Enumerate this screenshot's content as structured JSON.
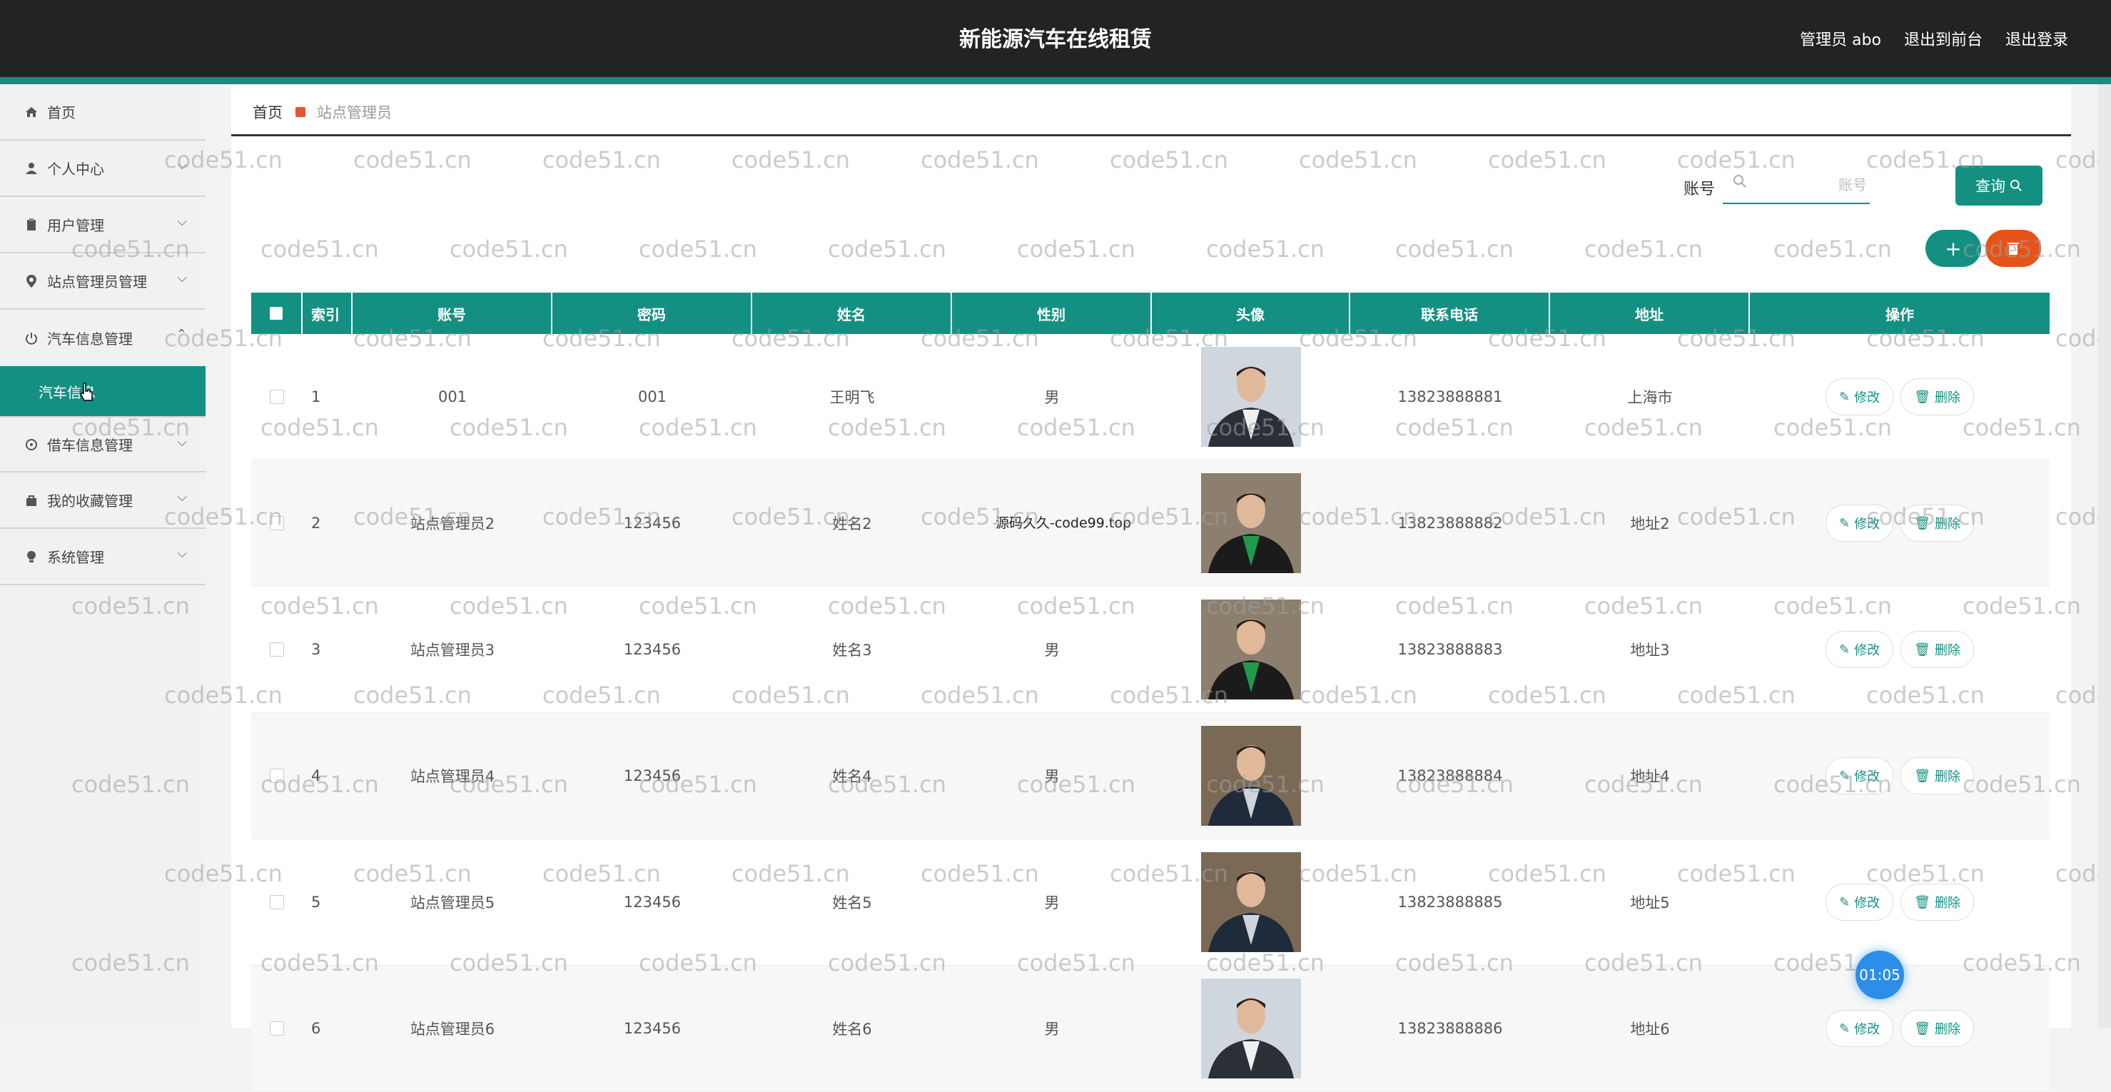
{
  "header": {
    "title": "新能源汽车在线租赁",
    "admin_label": "管理员 abo",
    "exit_front": "退出到前台",
    "logout": "退出登录"
  },
  "sidebar": {
    "items": [
      {
        "label": "首页",
        "icon": "home-icon"
      },
      {
        "label": "个人中心",
        "icon": "user-icon"
      },
      {
        "label": "用户管理",
        "icon": "clipboard-icon"
      },
      {
        "label": "站点管理员管理",
        "icon": "location-icon"
      },
      {
        "label": "汽车信息管理",
        "icon": "power-icon"
      },
      {
        "label": "借车信息管理",
        "icon": "settings-icon"
      },
      {
        "label": "我的收藏管理",
        "icon": "bag-icon"
      },
      {
        "label": "系统管理",
        "icon": "bulb-icon"
      }
    ],
    "active_sub": "汽车信息"
  },
  "breadcrumb": {
    "home": "首页",
    "current": "站点管理员"
  },
  "search": {
    "label": "账号",
    "placeholder": "账号",
    "query_label": "查询"
  },
  "table": {
    "headers": [
      "索引",
      "账号",
      "密码",
      "姓名",
      "性别",
      "头像",
      "联系电话",
      "地址",
      "操作"
    ],
    "edit_label": "修改",
    "delete_label": "删除",
    "rows": [
      {
        "index": "1",
        "account": "001",
        "password": "001",
        "name": "王明飞",
        "gender": "男",
        "phone": "13823888881",
        "address": "上海市"
      },
      {
        "index": "2",
        "account": "站点管理员2",
        "password": "123456",
        "name": "姓名2",
        "gender": "",
        "phone": "13823888882",
        "address": "地址2"
      },
      {
        "index": "3",
        "account": "站点管理员3",
        "password": "123456",
        "name": "姓名3",
        "gender": "男",
        "phone": "13823888883",
        "address": "地址3"
      },
      {
        "index": "4",
        "account": "站点管理员4",
        "password": "123456",
        "name": "姓名4",
        "gender": "男",
        "phone": "13823888884",
        "address": "地址4"
      },
      {
        "index": "5",
        "account": "站点管理员5",
        "password": "123456",
        "name": "姓名5",
        "gender": "男",
        "phone": "13823888885",
        "address": "地址5"
      },
      {
        "index": "6",
        "account": "站点管理员6",
        "password": "123456",
        "name": "姓名6",
        "gender": "男",
        "phone": "13823888886",
        "address": "地址6"
      }
    ]
  },
  "overlay_text": "源码久久-code99.top",
  "watermark_text": "code51.cn",
  "timer": "01:05",
  "colors": {
    "accent": "#149083",
    "danger": "#e65318",
    "topbar": "#232323"
  }
}
